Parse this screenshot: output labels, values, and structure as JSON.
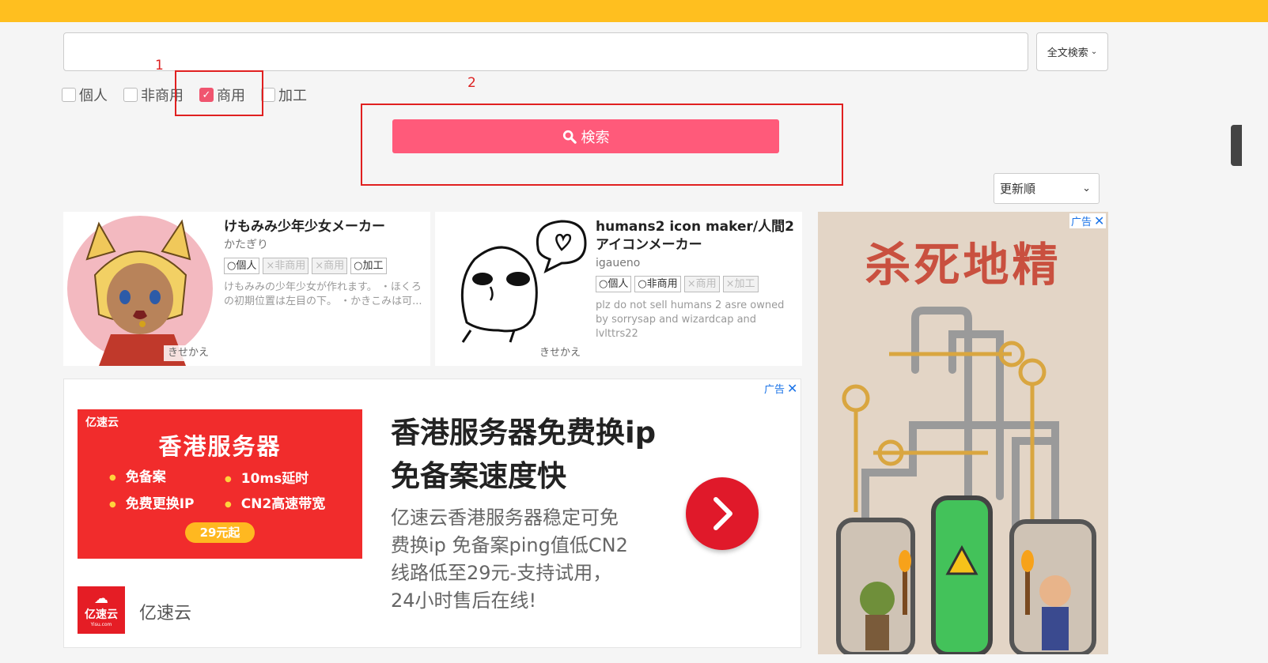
{
  "search": {
    "query": "",
    "mode_label": "全文検索"
  },
  "filters": [
    {
      "label": "個人",
      "checked": false
    },
    {
      "label": "非商用",
      "checked": false
    },
    {
      "label": "商用",
      "checked": true
    },
    {
      "label": "加工",
      "checked": false
    }
  ],
  "annotations": {
    "label_1": "1",
    "label_2": "2"
  },
  "search_button": {
    "label": "検索",
    "color": "#ff5a7a"
  },
  "sort": {
    "selected": "更新順"
  },
  "cards": [
    {
      "title": "けもみみ少年少女メーカー",
      "author": "かたぎり",
      "tags": [
        {
          "label": "○個人",
          "on": true
        },
        {
          "label": "×非商用",
          "on": false
        },
        {
          "label": "×商用",
          "on": false
        },
        {
          "label": "○加工",
          "on": true
        }
      ],
      "description": "けもみみの少年少女が作れます。 ・ほくろの初期位置は左目の下。 ・かきこみは可...",
      "badge": "きせかえ"
    },
    {
      "title": "humans2 icon maker/人間2アイコンメーカー",
      "author": "igaueno",
      "tags": [
        {
          "label": "○個人",
          "on": true
        },
        {
          "label": "○非商用",
          "on": true
        },
        {
          "label": "×商用",
          "on": false
        },
        {
          "label": "×加工",
          "on": false
        }
      ],
      "description": "plz do not sell humans 2 asre owned by sorrysap and wizardcap and lvlttrs22",
      "badge": "きせかえ"
    }
  ],
  "ad_wide": {
    "ad_mark": "广告",
    "image": {
      "brand": "亿速云",
      "headline": "香港服务器",
      "features": [
        "免备案",
        "10ms延时",
        "免费更换IP",
        "CN2高速带宽"
      ],
      "price": "29元起"
    },
    "headline": "香港服务器免费换ip免备案速度快",
    "body": "亿速云香港服务器稳定可免费换ip 免备案ping值低CN2线路低至29元-支持试用，24小时售后在线!",
    "logo_name": "亿速云",
    "logo_url": "Yisu.com",
    "advertiser": "亿速云"
  },
  "ad_tall": {
    "ad_mark": "广告",
    "title": "杀死地精"
  },
  "colors": {
    "topbar": "#ffbf1f",
    "accent": "#ff5a7a",
    "annotation": "#e02020"
  }
}
